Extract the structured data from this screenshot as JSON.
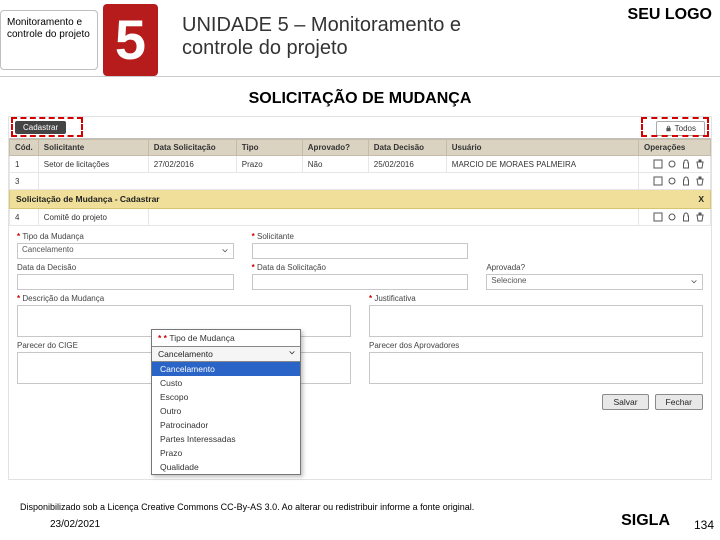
{
  "header": {
    "sidebar_label": "Monitoramento e controle do projeto",
    "number": "5",
    "title": "UNIDADE 5 – Monitoramento e controle do projeto",
    "logo": "SEU LOGO"
  },
  "section_title": "SOLICITAÇÃO DE MUDANÇA",
  "tabs": {
    "cadastrar": "Cadastrar",
    "todos": "Todos"
  },
  "grid": {
    "headers": [
      "Cód.",
      "Solicitante",
      "Data Solicitação",
      "Tipo",
      "Aprovado?",
      "Data Decisão",
      "Usuário",
      "Operações"
    ],
    "rows": [
      {
        "cod": "1",
        "solicitante": "Setor de licitações",
        "data_sol": "27/02/2016",
        "tipo": "Prazo",
        "aprovado": "Não",
        "data_dec": "25/02/2016",
        "usuario": "MARCIO DE MORAES PALMEIRA"
      },
      {
        "cod": "3",
        "solicitante": "",
        "data_sol": "",
        "tipo": "",
        "aprovado": "",
        "data_dec": "",
        "usuario": ""
      },
      {
        "cod": "4",
        "solicitante": "Comitê do projeto",
        "data_sol": "",
        "tipo": "",
        "aprovado": "",
        "data_dec": "",
        "usuario": ""
      }
    ]
  },
  "yellow_bar": {
    "title": "Solicitação de Mudança - Cadastrar",
    "close": "X"
  },
  "form": {
    "tipo_mudanca": {
      "label": "Tipo da Mudança",
      "value": "Cancelamento"
    },
    "solicitante": {
      "label": "Solicitante"
    },
    "data_decisao": {
      "label": "Data da Decisão"
    },
    "data_solicitacao": {
      "label": "Data da Solicitação"
    },
    "aprovada": {
      "label": "Aprovada?",
      "value": "Selecione"
    },
    "descricao": {
      "label": "Descrição da Mudança"
    },
    "justificativa": {
      "label": "Justificativa"
    },
    "parecer_cge": {
      "label": "Parecer do CIGE"
    },
    "parecer_aprov": {
      "label": "Parecer dos Aprovadores"
    }
  },
  "buttons": {
    "salvar": "Salvar",
    "fechar": "Fechar"
  },
  "dropdown": {
    "field_label": "Tipo de Mudança",
    "selected": "Cancelamento",
    "options": [
      "Cancelamento",
      "Custo",
      "Escopo",
      "Outro",
      "Patrocinador",
      "Partes Interessadas",
      "Prazo",
      "Qualidade"
    ]
  },
  "footer": {
    "license": "Disponibilizado sob a Licença Creative Commons CC-By-AS 3.0. Ao alterar ou redistribuir informe a fonte original.",
    "date": "23/02/2021",
    "sigla": "SIGLA",
    "page": "134"
  }
}
